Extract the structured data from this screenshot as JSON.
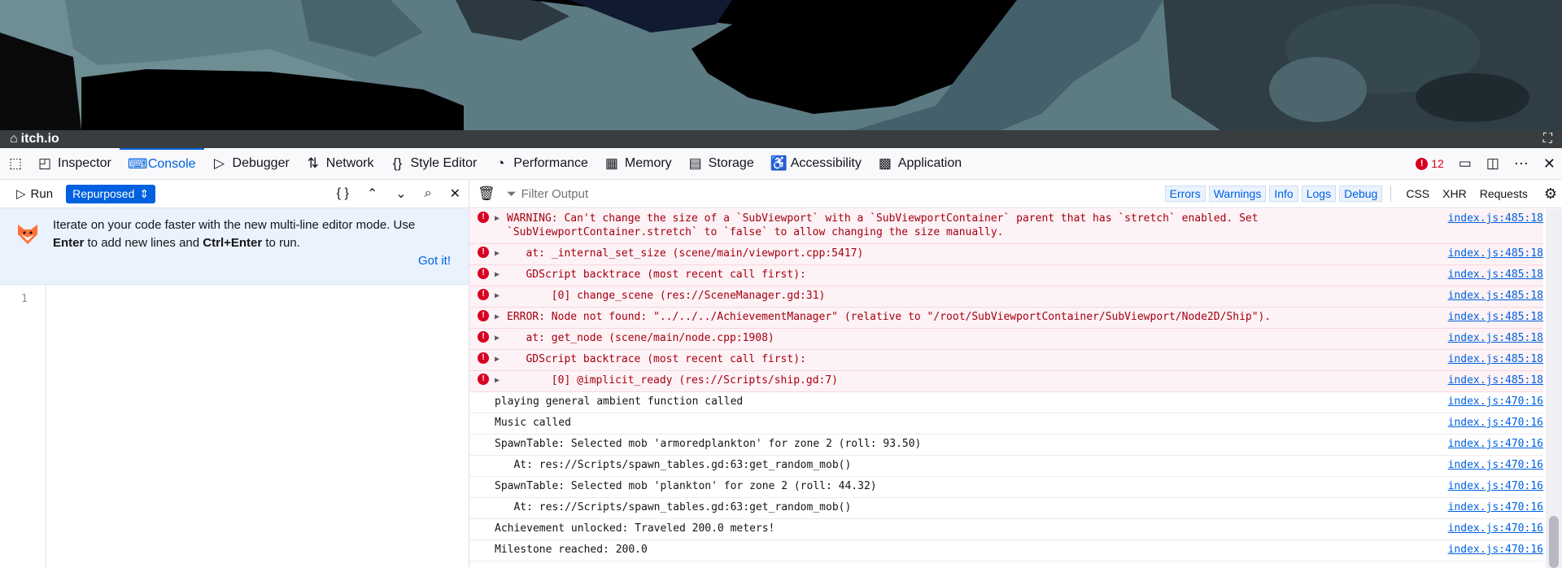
{
  "game": {
    "site_name": "itch.io"
  },
  "toolbar": {
    "tabs": [
      {
        "label": "Inspector",
        "icon": "inspector-icon"
      },
      {
        "label": "Console",
        "icon": "console-icon",
        "selected": true
      },
      {
        "label": "Debugger",
        "icon": "debugger-icon"
      },
      {
        "label": "Network",
        "icon": "network-icon"
      },
      {
        "label": "Style Editor",
        "icon": "style-editor-icon"
      },
      {
        "label": "Performance",
        "icon": "performance-icon"
      },
      {
        "label": "Memory",
        "icon": "memory-icon"
      },
      {
        "label": "Storage",
        "icon": "storage-icon"
      },
      {
        "label": "Accessibility",
        "icon": "accessibility-icon"
      },
      {
        "label": "Application",
        "icon": "application-icon"
      }
    ],
    "error_count": "12"
  },
  "editor": {
    "run_label": "Run",
    "mode_label": "Repurposed",
    "notice_line1": "Iterate on your code faster with the new multi-line editor mode. Use",
    "notice_enter": "Enter",
    "notice_mid": " to add new lines and ",
    "notice_ctrl": "Ctrl+Enter",
    "notice_end": " to run.",
    "got_it": "Got it!",
    "line_number": "1"
  },
  "console": {
    "filter_placeholder": "Filter Output",
    "levels": [
      "Errors",
      "Warnings",
      "Info",
      "Logs",
      "Debug"
    ],
    "extra_filters": [
      "CSS",
      "XHR",
      "Requests"
    ],
    "messages": [
      {
        "type": "error",
        "text": "WARNING: Can't change the size of a `SubViewport` with a `SubViewportContainer` parent that has `stretch` enabled. Set `SubViewportContainer.stretch` to `false` to allow changing the size manually.",
        "source": "index.js:485:18"
      },
      {
        "type": "error",
        "text": "   at: _internal_set_size (scene/main/viewport.cpp:5417)",
        "source": "index.js:485:18"
      },
      {
        "type": "error",
        "text": "   GDScript backtrace (most recent call first):",
        "source": "index.js:485:18"
      },
      {
        "type": "error",
        "text": "       [0] change_scene (res://SceneManager.gd:31)",
        "source": "index.js:485:18"
      },
      {
        "type": "error",
        "text": "ERROR: Node not found: \"../../../AchievementManager\" (relative to \"/root/SubViewportContainer/SubViewport/Node2D/Ship\").",
        "source": "index.js:485:18"
      },
      {
        "type": "error",
        "text": "   at: get_node (scene/main/node.cpp:1908)",
        "source": "index.js:485:18"
      },
      {
        "type": "error",
        "text": "   GDScript backtrace (most recent call first):",
        "source": "index.js:485:18"
      },
      {
        "type": "error",
        "text": "       [0] @implicit_ready (res://Scripts/ship.gd:7)",
        "source": "index.js:485:18"
      },
      {
        "type": "log",
        "text": "playing general ambient function called",
        "source": "index.js:470:16"
      },
      {
        "type": "log",
        "text": "Music called",
        "source": "index.js:470:16"
      },
      {
        "type": "log",
        "text": "SpawnTable: Selected mob 'armoredplankton' for zone 2 (roll: 93.50)",
        "source": "index.js:470:16"
      },
      {
        "type": "log",
        "text": "   At: res://Scripts/spawn_tables.gd:63:get_random_mob()",
        "source": "index.js:470:16"
      },
      {
        "type": "log",
        "text": "SpawnTable: Selected mob 'plankton' for zone 2 (roll: 44.32)",
        "source": "index.js:470:16"
      },
      {
        "type": "log",
        "text": "   At: res://Scripts/spawn_tables.gd:63:get_random_mob()",
        "source": "index.js:470:16"
      },
      {
        "type": "log",
        "text": "Achievement unlocked: Traveled 200.0 meters!",
        "source": "index.js:470:16"
      },
      {
        "type": "log",
        "text": "Milestone reached: 200.0",
        "source": "index.js:470:16"
      }
    ]
  }
}
